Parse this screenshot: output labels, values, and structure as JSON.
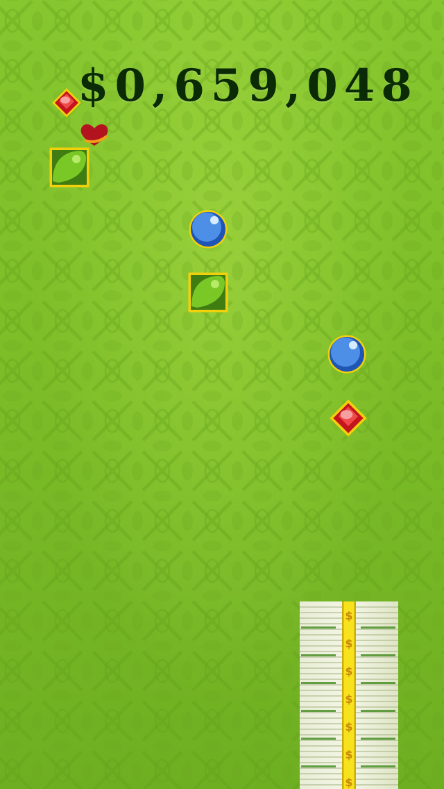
{
  "hud": {
    "score_text": "$0,659,048"
  },
  "pieces": [
    {
      "type": "ruby",
      "icon": "red-diamond-gem-icon",
      "color": "#d81e2a"
    },
    {
      "type": "heart",
      "icon": "heart-icon",
      "color": "#b3121f"
    },
    {
      "type": "emerald",
      "icon": "green-square-gem-icon",
      "color": "#6cc21d"
    },
    {
      "type": "sapphire",
      "icon": "blue-sphere-gem-icon",
      "color": "#2f6fd6"
    },
    {
      "type": "emerald",
      "icon": "green-square-gem-icon",
      "color": "#6cc21d"
    },
    {
      "type": "sapphire",
      "icon": "blue-sphere-gem-icon",
      "color": "#2f6fd6"
    },
    {
      "type": "ruby",
      "icon": "red-diamond-gem-icon",
      "color": "#d81e2a"
    }
  ],
  "colors": {
    "background": "#7fbf2a",
    "score": "#0b2a06",
    "gem_border": "#f2d10c",
    "money_band": "#f7e21d"
  },
  "money_stack": {
    "icon": "money-stack-icon",
    "band_symbol": "$"
  }
}
